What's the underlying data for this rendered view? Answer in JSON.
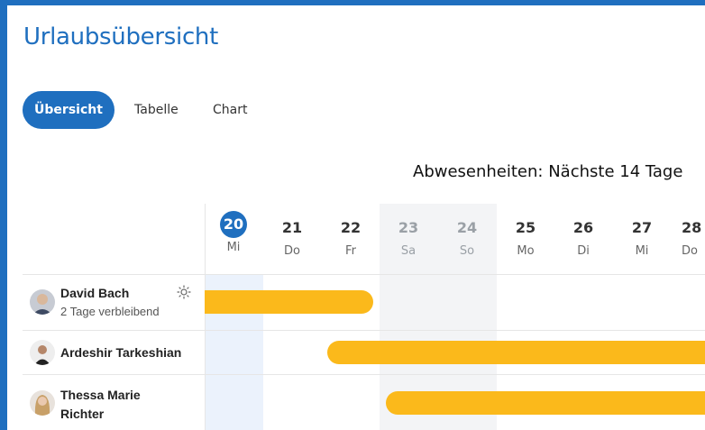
{
  "app": {
    "title": "Urlaubsübersicht"
  },
  "tabs": [
    {
      "label": "Übersicht",
      "active": true
    },
    {
      "label": "Tabelle",
      "active": false
    },
    {
      "label": "Chart",
      "active": false
    }
  ],
  "calendar": {
    "heading": "Abwesenheiten: Nächste 14 Tage",
    "days": [
      {
        "num": "20",
        "weekday": "Mi",
        "today": true,
        "weekend": false
      },
      {
        "num": "21",
        "weekday": "Do",
        "today": false,
        "weekend": false
      },
      {
        "num": "22",
        "weekday": "Fr",
        "today": false,
        "weekend": false
      },
      {
        "num": "23",
        "weekday": "Sa",
        "today": false,
        "weekend": true
      },
      {
        "num": "24",
        "weekday": "So",
        "today": false,
        "weekend": true
      },
      {
        "num": "25",
        "weekday": "Mo",
        "today": false,
        "weekend": false
      },
      {
        "num": "26",
        "weekday": "Di",
        "today": false,
        "weekend": false
      },
      {
        "num": "27",
        "weekday": "Mi",
        "today": false,
        "weekend": false
      },
      {
        "num": "28",
        "weekday": "Do",
        "today": false,
        "weekend": false
      }
    ]
  },
  "people": [
    {
      "name": "David Bach",
      "subtitle": "2 Tage verbleibend",
      "status_icon": "sun-icon"
    },
    {
      "name": "Ardeshir Tarkeshian",
      "subtitle": ""
    },
    {
      "name_line1": "Thessa Marie",
      "name_line2": "Richter",
      "subtitle": ""
    }
  ],
  "colors": {
    "accent": "#1f6fbf",
    "absence_bar": "#fbb91b",
    "weekend": "#f3f4f6",
    "today_band": "#ebf2fc"
  }
}
